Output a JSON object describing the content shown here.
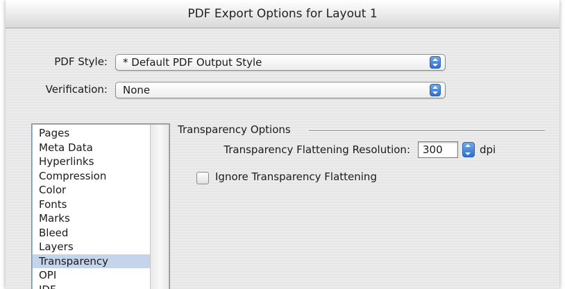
{
  "window": {
    "title": "PDF Export Options for Layout 1"
  },
  "pdf_style": {
    "label": "PDF Style:",
    "value": "* Default PDF Output Style"
  },
  "verification": {
    "label": "Verification:",
    "value": "None"
  },
  "sidebar": {
    "items": [
      {
        "label": "Pages"
      },
      {
        "label": "Meta Data"
      },
      {
        "label": "Hyperlinks"
      },
      {
        "label": "Compression"
      },
      {
        "label": "Color"
      },
      {
        "label": "Fonts"
      },
      {
        "label": "Marks"
      },
      {
        "label": "Bleed"
      },
      {
        "label": "Layers"
      },
      {
        "label": "Transparency",
        "selected": true
      },
      {
        "label": "OPI"
      },
      {
        "label": "JDF"
      }
    ]
  },
  "transparency": {
    "group_title": "Transparency Options",
    "resolution_label": "Transparency Flattening Resolution:",
    "resolution_value": "300",
    "resolution_unit": "dpi",
    "ignore_label": "Ignore Transparency Flattening",
    "ignore_checked": false
  },
  "colors": {
    "accent": "#2f6fd1",
    "selection": "#c4d4ea"
  }
}
